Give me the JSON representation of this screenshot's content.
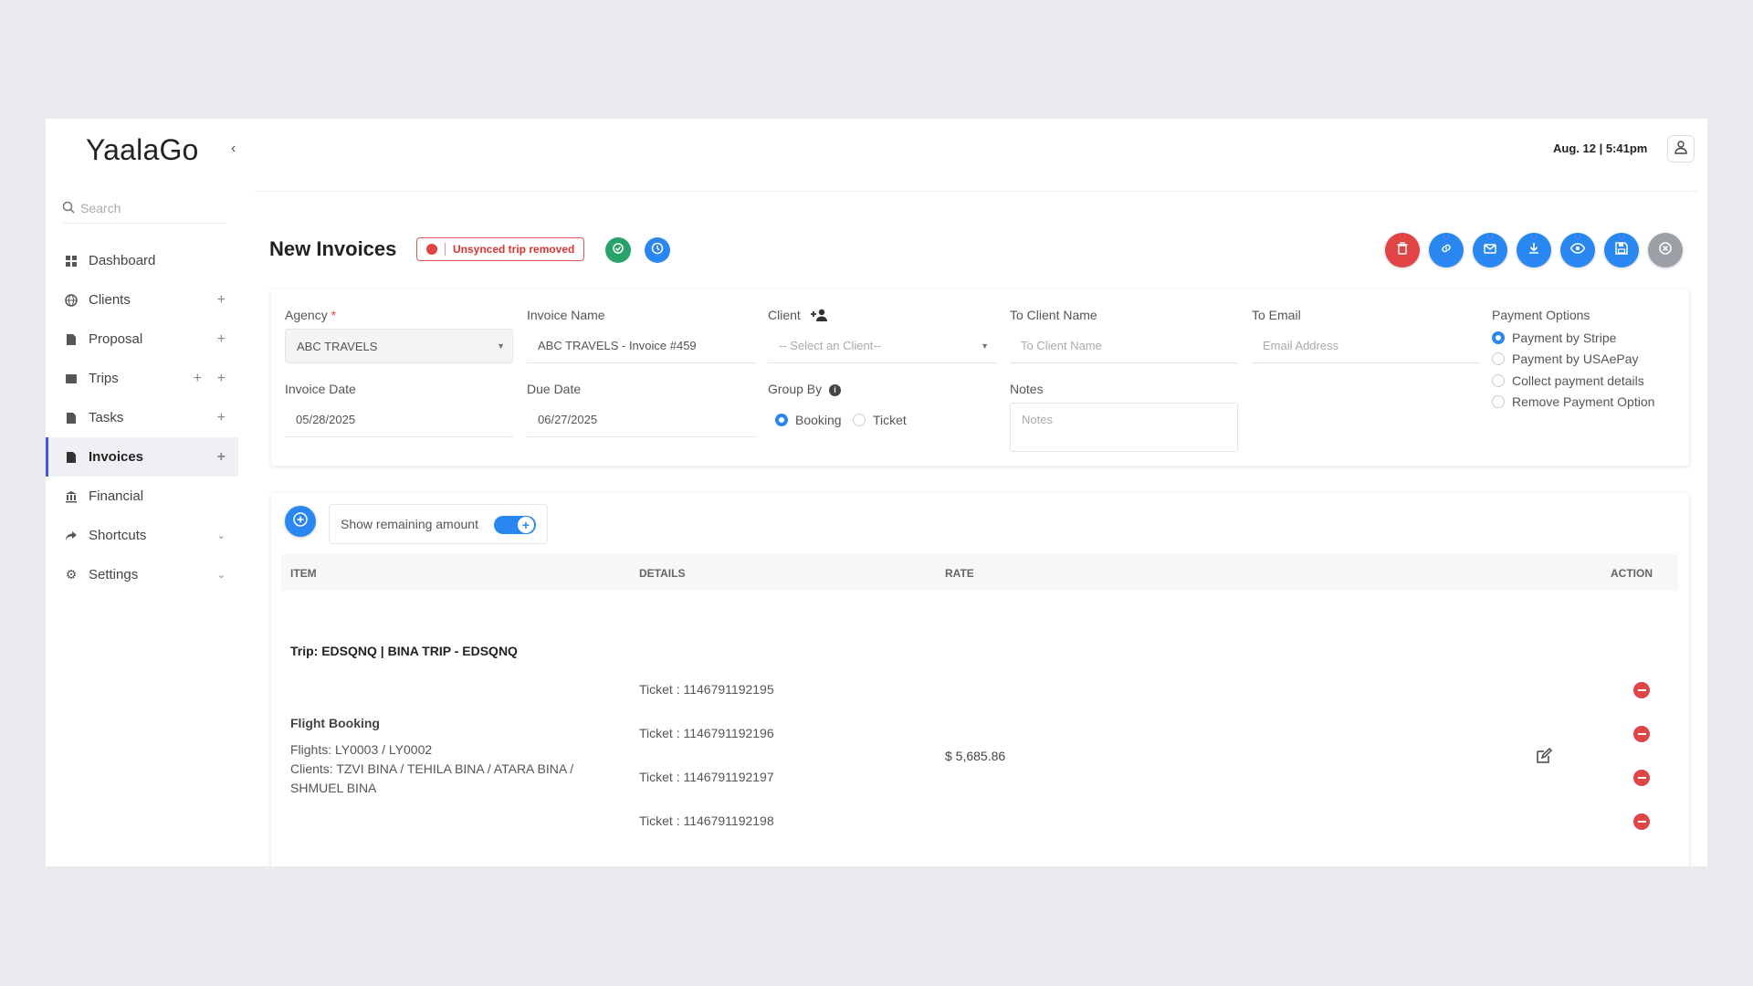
{
  "app": {
    "logo": "YaalaGo",
    "datetime": "Aug. 12 | 5:41pm"
  },
  "sidebar": {
    "search_placeholder": "Search",
    "items": [
      {
        "label": "Dashboard"
      },
      {
        "label": "Clients"
      },
      {
        "label": "Proposal"
      },
      {
        "label": "Trips"
      },
      {
        "label": "Tasks"
      },
      {
        "label": "Invoices"
      },
      {
        "label": "Financial"
      },
      {
        "label": "Shortcuts"
      },
      {
        "label": "Settings"
      }
    ],
    "active": "Invoices"
  },
  "header": {
    "title": "New Invoices",
    "badge": "Unsynced trip removed"
  },
  "form": {
    "agency": {
      "label": "Agency",
      "required_mark": "*",
      "value": "ABC TRAVELS"
    },
    "invoice_name": {
      "label": "Invoice Name",
      "value": "ABC TRAVELS - Invoice #459"
    },
    "client": {
      "label": "Client",
      "placeholder": "-- Select an Client--"
    },
    "to_client_name": {
      "label": "To Client Name",
      "placeholder": "To Client Name"
    },
    "to_email": {
      "label": "To Email",
      "placeholder": "Email Address"
    },
    "invoice_date": {
      "label": "Invoice Date",
      "value": "05/28/2025"
    },
    "due_date": {
      "label": "Due Date",
      "value": "06/27/2025"
    },
    "group_by": {
      "label": "Group By",
      "options": [
        "Booking",
        "Ticket"
      ],
      "selected": "Booking"
    },
    "notes": {
      "label": "Notes",
      "placeholder": "Notes"
    },
    "payment_options": {
      "label": "Payment Options",
      "options": [
        "Payment by Stripe",
        "Payment by USAePay",
        "Collect payment details",
        "Remove Payment Option"
      ],
      "selected": "Payment by Stripe"
    }
  },
  "items": {
    "toggle_label": "Show remaining amount",
    "toggle_on": true,
    "columns": [
      "ITEM",
      "DETAILS",
      "RATE",
      "ACTION"
    ],
    "trip_title": "Trip: EDSQNQ | BINA TRIP - EDSQNQ",
    "tickets": [
      "Ticket : 1146791192195",
      "Ticket : 1146791192196",
      "Ticket : 1146791192197",
      "Ticket : 1146791192198"
    ],
    "booking": {
      "title": "Flight Booking",
      "flights": "Flights: LY0003 / LY0002",
      "clients": "Clients: TZVI BINA / TEHILA BINA / ATARA BINA / SHMUEL BINA"
    },
    "rate": "$ 5,685.86"
  },
  "colors": {
    "primary": "#2a86f0",
    "danger": "#e04444",
    "success": "#27a36a",
    "muted": "#9aa0a6"
  },
  "icons": [
    "search-icon",
    "user-icon",
    "sync-icon",
    "history-icon",
    "trash-icon",
    "link-icon",
    "mail-icon",
    "download-icon",
    "eye-icon",
    "save-icon",
    "close-icon",
    "add-client-icon",
    "info-icon",
    "edit-icon"
  ]
}
